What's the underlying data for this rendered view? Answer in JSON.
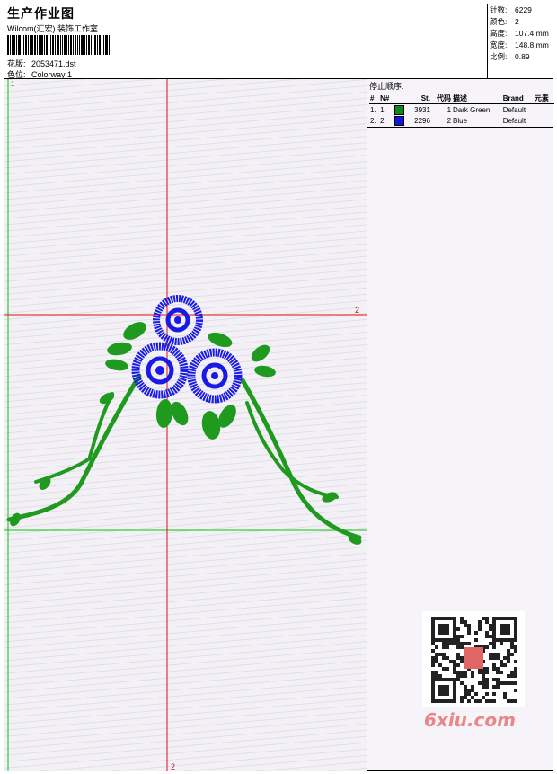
{
  "header": {
    "title": "生产作业图",
    "company": "Wilcom(汇宏) 装饰工作室",
    "design_label": "花版:",
    "design_value": "2053471.dst",
    "colorway_label": "色位:",
    "colorway_value": "Colorway 1"
  },
  "stats": {
    "stitches_label": "针数:",
    "stitches_value": "6229",
    "colors_label": "颜色:",
    "colors_value": "2",
    "height_label": "高度:",
    "height_value": "107.4 mm",
    "width_label": "宽度:",
    "width_value": "148.8 mm",
    "scale_label": "比例:",
    "scale_value": "0.89"
  },
  "canvas": {
    "corner_marker": "1",
    "h_axis_marker": "2",
    "v_axis_marker": "2"
  },
  "stop_sequence": {
    "title": "停止顺序:",
    "headers": [
      "#",
      "N#",
      "St.",
      "代码",
      "描述",
      "Brand",
      "元素"
    ],
    "rows": [
      {
        "num": "1.",
        "n": "1",
        "color": "#0a8a1a",
        "st": "3931",
        "code": "1",
        "desc": "Dark Green",
        "brand": "Default",
        "elem": ""
      },
      {
        "num": "2.",
        "n": "2",
        "color": "#1414e0",
        "st": "2296",
        "code": "2",
        "desc": "Blue",
        "brand": "Default",
        "elem": ""
      }
    ]
  },
  "watermark": "6xiu.com",
  "colors": {
    "green": "#1f9a1f",
    "blue": "#1a1ae6",
    "red_axis": "#e01010",
    "green_axis": "#10c010"
  }
}
